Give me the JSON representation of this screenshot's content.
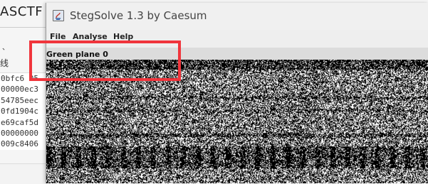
{
  "background_app": {
    "title": "ASCTF",
    "dot": "、",
    "cjk_text": "线",
    "hex_rows": [
      "0bfc6 05",
      "00000ec3",
      "54785eec",
      "0fd1904c",
      "e69caf5d",
      "00000000",
      "009c8406"
    ]
  },
  "window": {
    "title": "StegSolve 1.3 by Caesum",
    "menu": {
      "file": "File",
      "analyse": "Analyse",
      "help": "Help"
    },
    "plane_label": "Green plane 0"
  },
  "colors": {
    "highlight": "#f0353c"
  }
}
